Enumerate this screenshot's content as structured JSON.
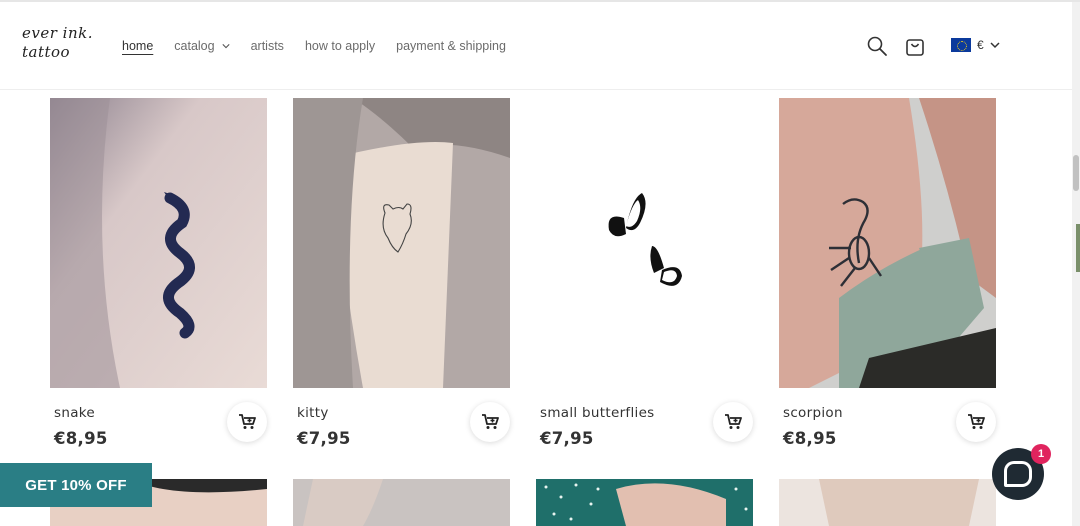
{
  "brand": {
    "line1": "ever ink.",
    "line2": "tattoo"
  },
  "nav": [
    {
      "label": "home",
      "active": true
    },
    {
      "label": "catalog",
      "dropdown": true
    },
    {
      "label": "artists"
    },
    {
      "label": "how to apply"
    },
    {
      "label": "payment & shipping"
    }
  ],
  "header_icons": [
    "search-icon",
    "bag-icon"
  ],
  "currency": {
    "symbol": "€",
    "flag": "eu-flag-icon"
  },
  "products": [
    {
      "title": "snake",
      "price": "€8,95"
    },
    {
      "title": "kitty",
      "price": "€7,95"
    },
    {
      "title": "small butterflies",
      "price": "€7,95"
    },
    {
      "title": "scorpion",
      "price": "€8,95"
    }
  ],
  "promo": {
    "label": "GET 10% OFF"
  },
  "chat": {
    "badge": "1"
  },
  "colors": {
    "accent": "#2a7e85",
    "badge": "#e0245e",
    "chat": "#1f2a33"
  }
}
